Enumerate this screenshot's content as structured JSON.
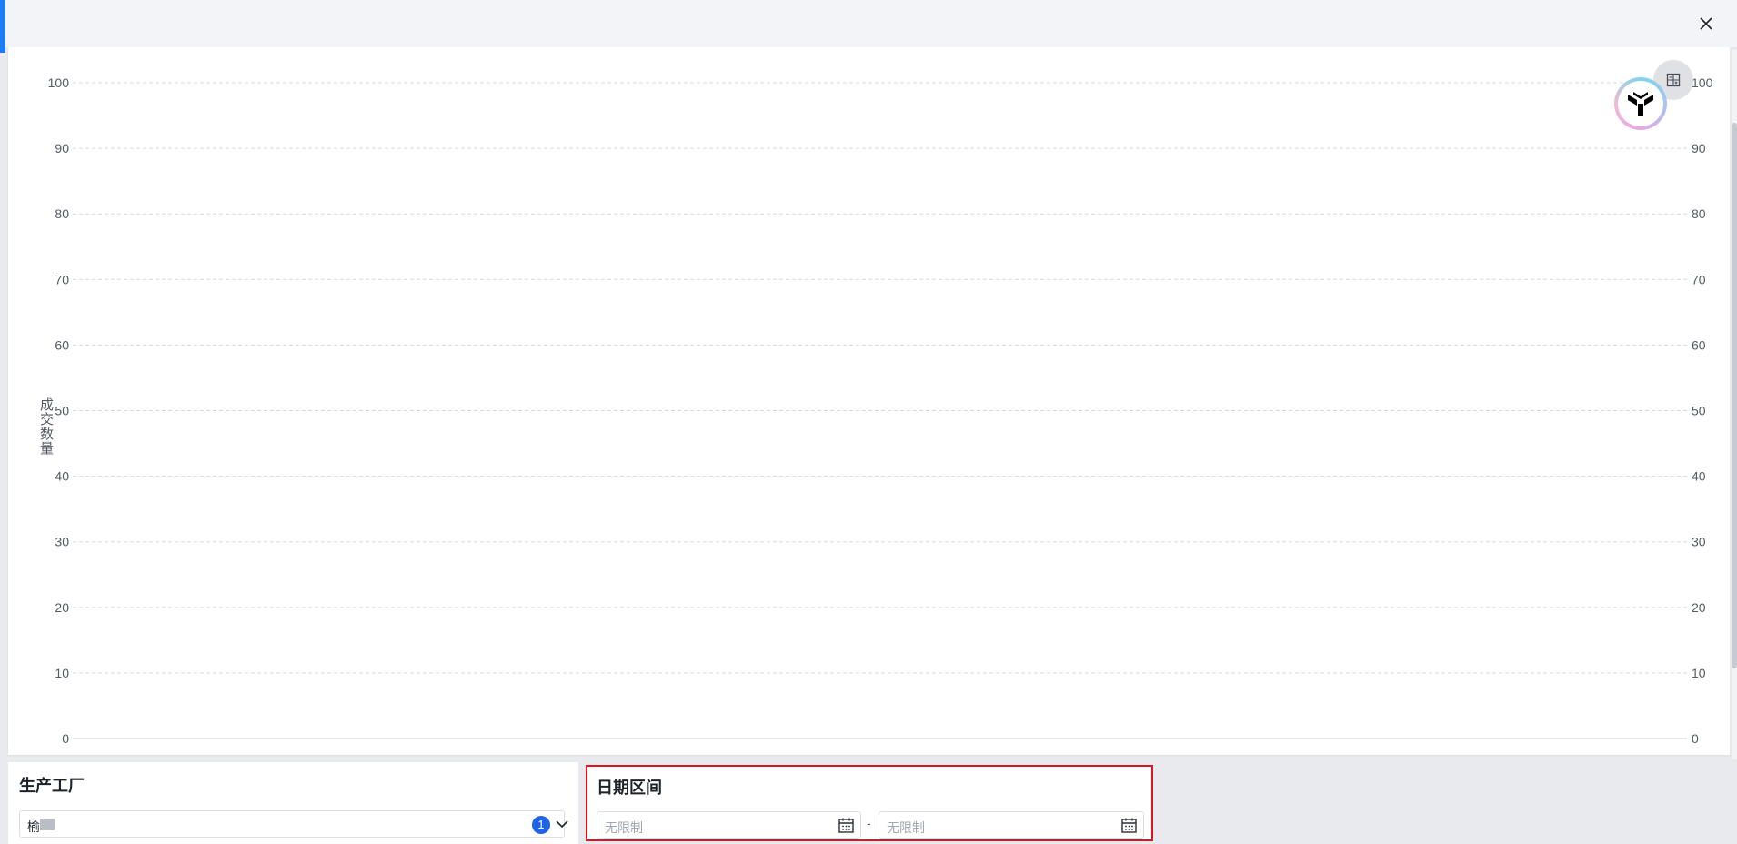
{
  "chart_data": {
    "type": "line",
    "ylabel": "成交数量",
    "ylim": [
      0,
      100
    ],
    "y_ticks": [
      "0",
      "10",
      "20",
      "30",
      "40",
      "50",
      "60",
      "70",
      "80",
      "90",
      "100"
    ],
    "y2_ticks": [
      "0",
      "10",
      "20",
      "30",
      "40",
      "50",
      "60",
      "70",
      "80",
      "90",
      "100"
    ],
    "grid": true,
    "categories": [],
    "series": []
  },
  "filters": {
    "factory": {
      "title": "生产工厂",
      "value": "榆",
      "count": "1"
    },
    "date_range": {
      "title": "日期区间",
      "start_placeholder": "无限制",
      "end_placeholder": "无限制",
      "separator": "-"
    }
  },
  "icons": {
    "close": "close-icon",
    "table_toggle": "table-view-icon",
    "assistant": "assistant-logo-icon",
    "calendar": "calendar-icon",
    "dropdown": "chevron-down-icon"
  },
  "colors": {
    "accent": "#1e7bf2",
    "badge": "#1e63e8",
    "highlight_border": "#e0141e"
  }
}
